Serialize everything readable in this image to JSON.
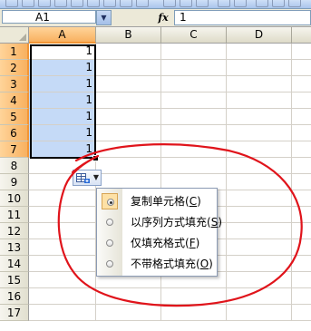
{
  "namebox": {
    "value": "A1"
  },
  "formula_bar": {
    "fx_label": "fx",
    "value": "1"
  },
  "columns": [
    "A",
    "B",
    "C",
    "D"
  ],
  "rows": [
    "1",
    "2",
    "3",
    "4",
    "5",
    "6",
    "7",
    "8",
    "9",
    "10",
    "11",
    "12",
    "13",
    "14",
    "15",
    "16",
    "17"
  ],
  "cells": {
    "A1": "1",
    "A2": "1",
    "A3": "1",
    "A4": "1",
    "A5": "1",
    "A6": "1",
    "A7": "1"
  },
  "selection": {
    "range": "A1:A7",
    "active_cell": "A1"
  },
  "autofill_menu": {
    "items": [
      {
        "label": "复制单元格",
        "accel": "C",
        "checked": true
      },
      {
        "label": "以序列方式填充",
        "accel": "S",
        "checked": false
      },
      {
        "label": "仅填充格式",
        "accel": "F",
        "checked": false
      },
      {
        "label": "不带格式填充",
        "accel": "O",
        "checked": false
      }
    ]
  },
  "colors": {
    "selection_fill": "#c5daf7",
    "header_highlight": "#f8b160",
    "annotation_red": "#e0141b"
  },
  "icons": {
    "autofill_options": "autofill-options-icon",
    "dropdown_arrow": "dropdown-arrow-icon"
  }
}
